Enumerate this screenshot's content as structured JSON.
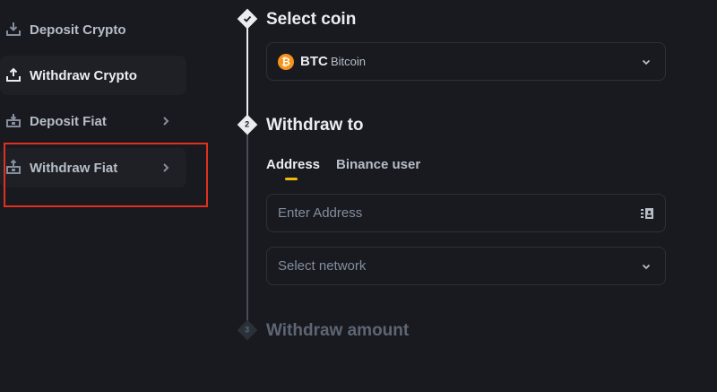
{
  "sidebar": {
    "items": [
      {
        "label": "Deposit Crypto",
        "icon": "download-icon"
      },
      {
        "label": "Withdraw Crypto",
        "icon": "upload-icon"
      },
      {
        "label": "Deposit Fiat",
        "icon": "deposit-fiat-icon"
      },
      {
        "label": "Withdraw Fiat",
        "icon": "withdraw-fiat-icon"
      }
    ]
  },
  "steps": [
    {
      "number": "",
      "title": "Select coin",
      "state": "done"
    },
    {
      "number": "2",
      "title": "Withdraw to",
      "state": "current"
    },
    {
      "number": "3",
      "title": "Withdraw amount",
      "state": "todo"
    }
  ],
  "coin": {
    "symbol": "BTC",
    "name": "Bitcoin",
    "glyph": "₿"
  },
  "tabs": [
    {
      "label": "Address",
      "active": true
    },
    {
      "label": "Binance user",
      "active": false
    }
  ],
  "address_field": {
    "placeholder": "Enter Address"
  },
  "network_field": {
    "placeholder": "Select network"
  },
  "colors": {
    "accent": "#f0b90b",
    "highlight": "#e1301f",
    "bitcoin": "#f7931a",
    "background": "#181a20"
  }
}
